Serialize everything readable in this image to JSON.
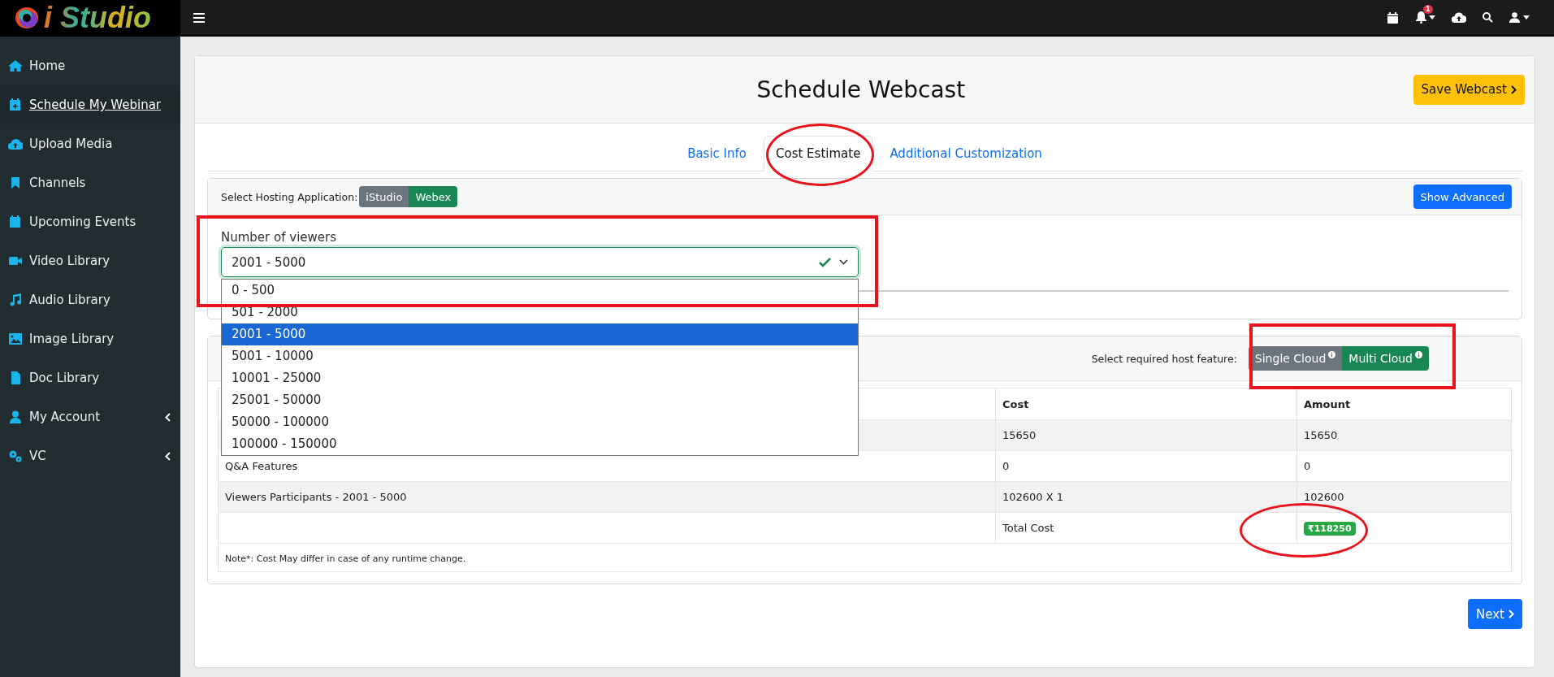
{
  "app": {
    "logo": "i Studio",
    "notification_count": "1"
  },
  "sidebar": {
    "items": [
      {
        "label": "Home",
        "selected": false,
        "expandable": false
      },
      {
        "label": "Schedule My Webinar",
        "selected": true,
        "expandable": false
      },
      {
        "label": "Upload Media",
        "selected": false,
        "expandable": false
      },
      {
        "label": "Channels",
        "selected": false,
        "expandable": false
      },
      {
        "label": "Upcoming Events",
        "selected": false,
        "expandable": false
      },
      {
        "label": "Video Library",
        "selected": false,
        "expandable": false
      },
      {
        "label": "Audio Library",
        "selected": false,
        "expandable": false
      },
      {
        "label": "Image Library",
        "selected": false,
        "expandable": false
      },
      {
        "label": "Doc Library",
        "selected": false,
        "expandable": false
      },
      {
        "label": "My Account",
        "selected": false,
        "expandable": true
      },
      {
        "label": "VC",
        "selected": false,
        "expandable": true
      }
    ]
  },
  "page": {
    "title": "Schedule Webcast",
    "save_button": "Save Webcast"
  },
  "tabs": [
    {
      "label": "Basic Info",
      "selected": false
    },
    {
      "label": "Cost Estimate",
      "selected": true
    },
    {
      "label": "Additional Customization",
      "selected": false
    }
  ],
  "hosting": {
    "label": "Select Hosting Application:",
    "options": [
      {
        "label": "iStudio",
        "selected": false
      },
      {
        "label": "Webex",
        "selected": true
      }
    ],
    "advanced_button": "Show Advanced"
  },
  "viewers": {
    "label": "Number of viewers",
    "value": "2001 - 5000",
    "valid": true,
    "expanded": true,
    "options": [
      {
        "label": "0 - 500",
        "selected": false
      },
      {
        "label": "501 - 2000",
        "selected": false
      },
      {
        "label": "2001 - 5000",
        "selected": true
      },
      {
        "label": "5001 - 10000",
        "selected": false
      },
      {
        "label": "10001 - 25000",
        "selected": false
      },
      {
        "label": "25001 - 50000",
        "selected": false
      },
      {
        "label": "50000 - 100000",
        "selected": false
      },
      {
        "label": "100000 - 150000",
        "selected": false
      }
    ]
  },
  "host_feature": {
    "label": "Select required host feature:",
    "options": [
      {
        "label": "Single Cloud",
        "selected": false
      },
      {
        "label": "Multi Cloud",
        "selected": true
      }
    ]
  },
  "cost_table": {
    "columns": [
      "Cost",
      "Amount"
    ],
    "rows": [
      {
        "cost": "15650",
        "amount": "15650"
      },
      {
        "item": "Q&A Features",
        "cost": "0",
        "amount": "0"
      },
      {
        "item": "Viewers Participants - 2001 - 5000",
        "cost": "102600 X 1",
        "amount": "102600"
      }
    ],
    "total": {
      "label": "Total Cost",
      "amount": "₹118250"
    }
  },
  "note": "Note*: Cost May differ in case of any runtime change.",
  "next_button": "Next"
}
